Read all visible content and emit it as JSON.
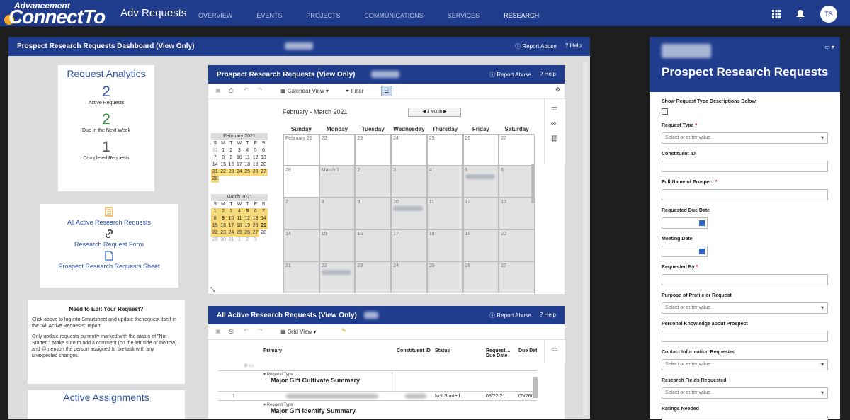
{
  "nav": {
    "logo_top": "Advancement",
    "logo_main": "ConnectTo",
    "app_title": "Adv Requests",
    "links": [
      "OVERVIEW",
      "EVENTS",
      "PROJECTS",
      "COMMUNICATIONS",
      "SERVICES",
      "RESEARCH"
    ],
    "avatar": "TS"
  },
  "dashboard": {
    "title": "Prospect Research Requests Dashboard (View Only)",
    "report": "Report Abuse",
    "help": "Help"
  },
  "analytics": {
    "title": "Request Analytics",
    "metrics": [
      {
        "value": "2",
        "label": "Active Requests",
        "color": "#2c52a8"
      },
      {
        "value": "2",
        "label": "Due in the Next Week",
        "color": "#2e8b3a"
      },
      {
        "value": "1",
        "label": "Completed Requests",
        "color": "#555555"
      }
    ]
  },
  "links": {
    "items": [
      "All Active Research Requests",
      "Research Request Form",
      "Prospect Research Requests Sheet"
    ]
  },
  "edit_note": {
    "title": "Need to Edit Your Request?",
    "p1": "Click above to log into Smartsheet and update the request itself in the \"All Active Requests\" report.",
    "p2": "Only update requests currently marked with the status of \"Not Started\". Make sure to add a comment (on the left side of the row) and @mention the person assigned to the task with any unexpected changes."
  },
  "assignments": {
    "title": "Active Assignments"
  },
  "calendar_widget": {
    "title": "Prospect Research Requests (View Only)",
    "report": "Report Abuse",
    "help": "Help",
    "view": "Calendar View",
    "filter": "Filter",
    "range": "February - March 2021",
    "period": "1 Month",
    "weekdays": [
      "Sunday",
      "Monday",
      "Tuesday",
      "Wednesday",
      "Thursday",
      "Friday",
      "Saturday"
    ],
    "weeks": [
      [
        "February 21",
        "22",
        "23",
        "24",
        "25",
        "26",
        "27"
      ],
      [
        "28",
        "March 1",
        "2",
        "3",
        "4",
        "5",
        "6"
      ],
      [
        "7",
        "8",
        "9",
        "10",
        "11",
        "12",
        "13"
      ],
      [
        "14",
        "15",
        "16",
        "17",
        "18",
        "19",
        "20"
      ],
      [
        "21",
        "22",
        "23",
        "24",
        "25",
        "26",
        "27"
      ]
    ],
    "mini_feb": {
      "title": "February 2021",
      "days": [
        "31",
        "1",
        "2",
        "3",
        "4",
        "5",
        "6",
        "7",
        "8",
        "9",
        "10",
        "11",
        "12",
        "13",
        "14",
        "15",
        "16",
        "17",
        "18",
        "19",
        "20",
        "21",
        "22",
        "23",
        "24",
        "25",
        "26",
        "27",
        "28"
      ]
    },
    "mini_mar": {
      "title": "March 2021",
      "days": [
        "1",
        "2",
        "3",
        "4",
        "5",
        "6",
        "7",
        "8",
        "9",
        "10",
        "11",
        "12",
        "13",
        "14",
        "15",
        "16",
        "17",
        "18",
        "19",
        "20",
        "21",
        "22",
        "23",
        "24",
        "25",
        "26",
        "27",
        "28",
        "29",
        "30",
        "31",
        "1",
        "2",
        "3"
      ]
    },
    "dow": [
      "S",
      "M",
      "T",
      "W",
      "T",
      "F",
      "S"
    ]
  },
  "report_widget": {
    "title": "All Active Research Requests (View Only)",
    "report": "Report Abuse",
    "help": "Help",
    "view": "Grid View",
    "cols": [
      "Primary",
      "Constituent ID",
      "Status",
      "Request… Due Date",
      "Due Date"
    ],
    "group1": {
      "label": "Request Type",
      "value": "Major Gift Cultivate Summary"
    },
    "row1": {
      "num": "1",
      "status": "Not Started",
      "due": "03/22/21",
      "due2": "05/26/"
    },
    "group2": {
      "label": "Request Type",
      "value": "Major Gift Identify Summary"
    }
  },
  "form": {
    "title": "Prospect Research Requests",
    "show_desc": "Show Request Type Descriptions Below",
    "f_type": "Request Type",
    "placeholder": "Select or enter value",
    "f_const": "Constituent ID",
    "f_name": "Full Name of Prospect",
    "f_due": "Requested Due Date",
    "f_meet": "Meeting Date",
    "f_by": "Requested By",
    "f_purpose": "Purpose of Profile or Request",
    "f_know": "Personal Knowledge about Prospect",
    "f_contact": "Contact Information Requested",
    "f_fields": "Research Fields Requested",
    "f_ratings": "Ratings Needed"
  }
}
